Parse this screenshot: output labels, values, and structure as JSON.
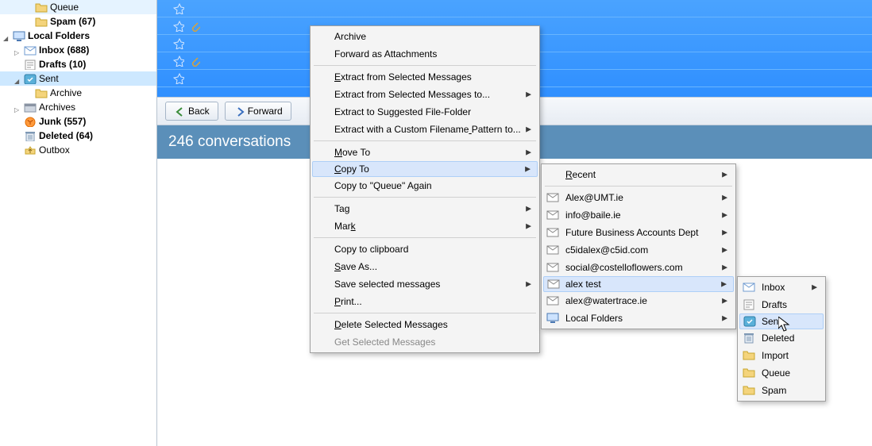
{
  "sidebar": {
    "items": [
      {
        "label": "Queue",
        "icon": "queue",
        "indent": 2,
        "twisty": "none",
        "bold": false
      },
      {
        "label": "Spam (67)",
        "icon": "spam",
        "indent": 2,
        "twisty": "none",
        "bold": true
      },
      {
        "label": "Local Folders",
        "icon": "computer",
        "indent": 0,
        "twisty": "expanded",
        "bold": true
      },
      {
        "label": "Inbox (688)",
        "icon": "inbox",
        "indent": 1,
        "twisty": "collapsed",
        "bold": true
      },
      {
        "label": "Drafts (10)",
        "icon": "drafts",
        "indent": 1,
        "twisty": "none",
        "bold": true
      },
      {
        "label": "Sent",
        "icon": "sent",
        "indent": 1,
        "twisty": "expanded",
        "bold": false,
        "selected": true
      },
      {
        "label": "Archive",
        "icon": "folder",
        "indent": 2,
        "twisty": "none",
        "bold": false
      },
      {
        "label": "Archives",
        "icon": "archives",
        "indent": 1,
        "twisty": "collapsed",
        "bold": false
      },
      {
        "label": "Junk (557)",
        "icon": "junk",
        "indent": 1,
        "twisty": "none",
        "bold": true
      },
      {
        "label": "Deleted (64)",
        "icon": "trash",
        "indent": 1,
        "twisty": "none",
        "bold": true
      },
      {
        "label": "Outbox",
        "icon": "outbox",
        "indent": 1,
        "twisty": "none",
        "bold": false
      }
    ]
  },
  "toolbar": {
    "back": "Back",
    "forward": "Forward"
  },
  "convo_header": "246 conversations",
  "context_menu_main": {
    "items": [
      {
        "label": "Archive",
        "type": "item"
      },
      {
        "label": "Forward as Attachments",
        "type": "item"
      },
      {
        "type": "sep"
      },
      {
        "label": "Extract from Selected Messages",
        "type": "item",
        "u": 0
      },
      {
        "label": "Extract from Selected Messages to...",
        "type": "submenu"
      },
      {
        "label": "Extract to Suggested File-Folder",
        "type": "item"
      },
      {
        "label": "Extract with a Custom Filename Pattern to...",
        "type": "submenu",
        "u": 30
      },
      {
        "type": "sep"
      },
      {
        "label": "Move To",
        "type": "submenu",
        "u": 0
      },
      {
        "label": "Copy To",
        "type": "submenu",
        "u": 0,
        "hover": true
      },
      {
        "label": "Copy to \"Queue\" Again",
        "type": "item",
        "u": 22
      },
      {
        "type": "sep"
      },
      {
        "label": "Tag",
        "type": "submenu",
        "u": 2
      },
      {
        "label": "Mark",
        "type": "submenu",
        "u": 3
      },
      {
        "type": "sep"
      },
      {
        "label": "Copy to clipboard",
        "type": "item"
      },
      {
        "label": "Save As...",
        "type": "item",
        "u": 0
      },
      {
        "label": "Save selected messages",
        "type": "submenu"
      },
      {
        "label": "Print...",
        "type": "item",
        "u": 0
      },
      {
        "type": "sep"
      },
      {
        "label": "Delete Selected Messages",
        "type": "item",
        "u": 0
      },
      {
        "label": "Get Selected Messages",
        "type": "item",
        "disabled": true
      }
    ]
  },
  "context_menu_accounts": {
    "items": [
      {
        "label": "Recent",
        "type": "submenu",
        "u": 0
      },
      {
        "type": "sep"
      },
      {
        "label": "Alex@UMT.ie",
        "type": "submenu",
        "icon": "mail"
      },
      {
        "label": "info@baile.ie",
        "type": "submenu",
        "icon": "mail"
      },
      {
        "label": "Future Business Accounts Dept",
        "type": "submenu",
        "icon": "mail"
      },
      {
        "label": "c5idalex@c5id.com",
        "type": "submenu",
        "icon": "mail"
      },
      {
        "label": "social@costelloflowers.com",
        "type": "submenu",
        "icon": "mail"
      },
      {
        "label": "alex test",
        "type": "submenu",
        "icon": "mail",
        "hover": true
      },
      {
        "label": "alex@watertrace.ie",
        "type": "submenu",
        "icon": "mail"
      },
      {
        "label": "Local Folders",
        "type": "submenu",
        "icon": "computer"
      }
    ]
  },
  "context_menu_folders": {
    "items": [
      {
        "label": "Inbox",
        "type": "submenu",
        "icon": "inbox"
      },
      {
        "label": "Drafts",
        "type": "item",
        "icon": "drafts"
      },
      {
        "label": "Sent",
        "type": "item",
        "icon": "sent",
        "hover": true
      },
      {
        "label": "Deleted",
        "type": "item",
        "icon": "trash"
      },
      {
        "label": "Import",
        "type": "item",
        "icon": "folder"
      },
      {
        "label": "Queue",
        "type": "item",
        "icon": "folder"
      },
      {
        "label": "Spam",
        "type": "item",
        "icon": "folder"
      }
    ]
  }
}
